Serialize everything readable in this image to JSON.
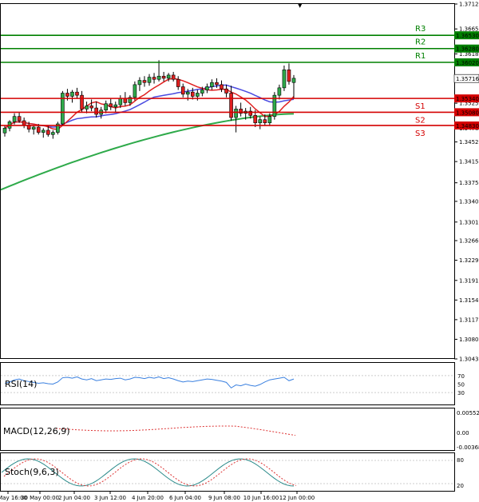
{
  "chart_data": {
    "type": "candlestick",
    "ylim": [
      1.3043,
      1.3712
    ],
    "y_ticks": [
      "1.37120",
      "1.36650",
      "1.36180",
      "1.35710",
      "1.35250",
      "1.34780",
      "1.34520",
      "1.34150",
      "1.33750",
      "1.33400",
      "1.33010",
      "1.32660",
      "1.32290",
      "1.31910",
      "1.31540",
      "1.31170",
      "1.30800",
      "1.30430"
    ],
    "x_ticks": [
      "29 May 16:00",
      "30 May 00:00",
      "2 Jun 04:00",
      "3 Jun 12:00",
      "4 Jun 20:00",
      "6 Jun 04:00",
      "9 Jun 08:00",
      "10 Jun 16:00",
      "12 Jun 00:00"
    ],
    "levels": [
      {
        "name": "R3",
        "value": 1.3653,
        "label": "1.36530",
        "color": "#008000"
      },
      {
        "name": "R2",
        "value": 1.3628,
        "label": "1.36280",
        "color": "#008000"
      },
      {
        "name": "R1",
        "value": 1.3602,
        "label": "1.36020",
        "color": "#008000"
      },
      {
        "name": "S1",
        "value": 1.3534,
        "label": "1.35340",
        "color": "#d40000"
      },
      {
        "name": "S2",
        "value": 1.3508,
        "label": "1.35080",
        "color": "#d40000"
      },
      {
        "name": "S3",
        "value": 1.3483,
        "label": "1.34830",
        "color": "#d40000"
      }
    ],
    "current_price": {
      "label": "1.35716",
      "value": 1.35716
    },
    "candles": [
      [
        1.3469,
        1.3482,
        1.3462,
        1.3478
      ],
      [
        1.3478,
        1.3493,
        1.3472,
        1.349
      ],
      [
        1.349,
        1.3506,
        1.3485,
        1.35
      ],
      [
        1.35,
        1.3508,
        1.3488,
        1.3492
      ],
      [
        1.3492,
        1.3498,
        1.3478,
        1.3484
      ],
      [
        1.3484,
        1.349,
        1.347,
        1.3476
      ],
      [
        1.3476,
        1.3484,
        1.3466,
        1.348
      ],
      [
        1.348,
        1.3486,
        1.3466,
        1.347
      ],
      [
        1.347,
        1.3478,
        1.346,
        1.3474
      ],
      [
        1.3474,
        1.3482,
        1.3462,
        1.3466
      ],
      [
        1.3466,
        1.3474,
        1.3458,
        1.347
      ],
      [
        1.347,
        1.349,
        1.3466,
        1.3486
      ],
      [
        1.3486,
        1.3548,
        1.3482,
        1.3544
      ],
      [
        1.3544,
        1.3552,
        1.353,
        1.3538
      ],
      [
        1.3538,
        1.355,
        1.3526,
        1.3546
      ],
      [
        1.3546,
        1.3554,
        1.3534,
        1.354
      ],
      [
        1.354,
        1.3548,
        1.3508,
        1.3514
      ],
      [
        1.3514,
        1.3528,
        1.3506,
        1.352
      ],
      [
        1.352,
        1.3532,
        1.351,
        1.3516
      ],
      [
        1.3516,
        1.3528,
        1.3498,
        1.3504
      ],
      [
        1.3504,
        1.3518,
        1.3496,
        1.3512
      ],
      [
        1.3512,
        1.353,
        1.3506,
        1.3524
      ],
      [
        1.3524,
        1.3534,
        1.3512,
        1.3518
      ],
      [
        1.3518,
        1.3528,
        1.3508,
        1.3522
      ],
      [
        1.3522,
        1.354,
        1.3516,
        1.3534
      ],
      [
        1.3534,
        1.3546,
        1.352,
        1.3526
      ],
      [
        1.3526,
        1.354,
        1.352,
        1.3536
      ],
      [
        1.3536,
        1.3566,
        1.353,
        1.356
      ],
      [
        1.356,
        1.3574,
        1.3548,
        1.3568
      ],
      [
        1.3568,
        1.3576,
        1.3556,
        1.3564
      ],
      [
        1.3564,
        1.358,
        1.3558,
        1.3574
      ],
      [
        1.3574,
        1.3582,
        1.3562,
        1.357
      ],
      [
        1.357,
        1.3606,
        1.3566,
        1.3576
      ],
      [
        1.3576,
        1.3584,
        1.3566,
        1.3572
      ],
      [
        1.3572,
        1.3582,
        1.3566,
        1.3578
      ],
      [
        1.3578,
        1.3584,
        1.3566,
        1.357
      ],
      [
        1.357,
        1.3576,
        1.355,
        1.3556
      ],
      [
        1.3556,
        1.3562,
        1.3536,
        1.3542
      ],
      [
        1.3542,
        1.3552,
        1.353,
        1.3546
      ],
      [
        1.3546,
        1.3554,
        1.3532,
        1.3538
      ],
      [
        1.3538,
        1.355,
        1.353,
        1.3544
      ],
      [
        1.3544,
        1.3556,
        1.3538,
        1.355
      ],
      [
        1.355,
        1.3562,
        1.3544,
        1.3556
      ],
      [
        1.3556,
        1.357,
        1.355,
        1.3564
      ],
      [
        1.3564,
        1.3572,
        1.3554,
        1.356
      ],
      [
        1.356,
        1.3568,
        1.3546,
        1.3552
      ],
      [
        1.3552,
        1.356,
        1.3536,
        1.3544
      ],
      [
        1.3544,
        1.3558,
        1.3492,
        1.3498
      ],
      [
        1.3498,
        1.352,
        1.347,
        1.3514
      ],
      [
        1.3514,
        1.3526,
        1.35,
        1.3506
      ],
      [
        1.3506,
        1.3516,
        1.3494,
        1.351
      ],
      [
        1.351,
        1.3518,
        1.3496,
        1.3502
      ],
      [
        1.3502,
        1.3512,
        1.348,
        1.3488
      ],
      [
        1.3488,
        1.35,
        1.3476,
        1.3494
      ],
      [
        1.3494,
        1.3504,
        1.3482,
        1.3488
      ],
      [
        1.3488,
        1.3506,
        1.3482,
        1.35
      ],
      [
        1.35,
        1.3546,
        1.3494,
        1.354
      ],
      [
        1.354,
        1.356,
        1.3532,
        1.3554
      ],
      [
        1.3554,
        1.3596,
        1.3548,
        1.3588
      ],
      [
        1.3588,
        1.36,
        1.356,
        1.3566
      ],
      [
        1.3564,
        1.3578,
        1.3534,
        1.3572
      ]
    ],
    "ma_red_period_label": "",
    "ma_blue_period_label": "",
    "ma_green_period_label": ""
  },
  "indicators": {
    "rsi": {
      "label": "RSI(14)",
      "ticks": [
        "70",
        "50",
        "30"
      ],
      "values": [
        52,
        55,
        60,
        62,
        58,
        56,
        54,
        52,
        53,
        51,
        50,
        55,
        65,
        66,
        64,
        67,
        62,
        60,
        63,
        58,
        60,
        62,
        61,
        63,
        64,
        60,
        62,
        66,
        65,
        63,
        66,
        64,
        67,
        63,
        65,
        62,
        58,
        55,
        57,
        56,
        58,
        60,
        62,
        61,
        59,
        57,
        54,
        41,
        48,
        46,
        50,
        47,
        45,
        49,
        55,
        60,
        62,
        64,
        66,
        58,
        62
      ]
    },
    "macd": {
      "label": "MACD(12,26,9)",
      "ticks": [
        "0.005524",
        "0.00",
        "-0.003689"
      ]
    },
    "stoch": {
      "label": "Stoch(9,6,3)",
      "ticks": [
        "80",
        "20"
      ]
    }
  }
}
